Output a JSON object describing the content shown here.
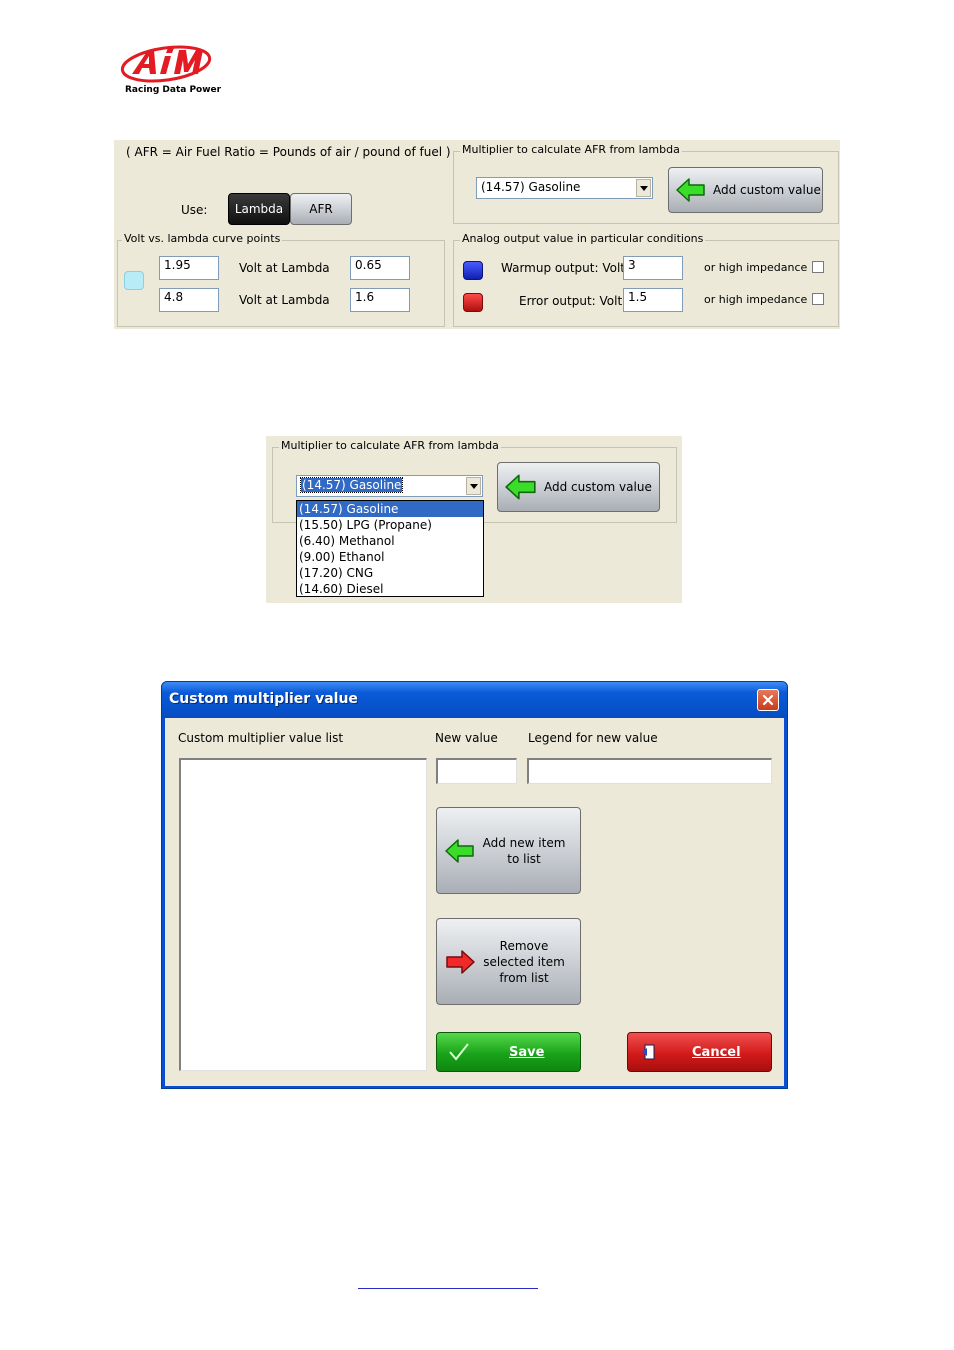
{
  "logo": {
    "brand": "AiM",
    "tagline": "Racing Data Power",
    "color": "#e31b23"
  },
  "panel1": {
    "afr_note": "( AFR = Air Fuel Ratio = Pounds of air / pound of fuel )",
    "use_label": "Use:",
    "toggle_lambda": "Lambda",
    "toggle_afr": "AFR",
    "multiplier_group_title": "Multiplier to calculate AFR from lambda",
    "multiplier_selected": "(14.57) Gasoline",
    "add_custom_label": "Add custom value",
    "curve_group_title": "Volt vs. lambda curve points",
    "curve_rows": [
      {
        "volt": "1.95",
        "volt_label": "Volt  at  Lambda",
        "lambda": "0.65"
      },
      {
        "volt": "4.8",
        "volt_label": "Volt  at  Lambda",
        "lambda": "1.6"
      }
    ],
    "analog_group_title": "Analog output value in particular conditions",
    "warmup_label": "Warmup output: Volt",
    "warmup_value": "3",
    "error_label": "Error output: Volt",
    "error_value": "1.5",
    "high_impedance_label": "or high impedance",
    "colors": {
      "warmup_led": "#1f2fc8",
      "error_led": "#d41414",
      "curve_led": "#b8ecf6"
    }
  },
  "panel2": {
    "group_title": "Multiplier to calculate AFR from lambda",
    "selected": "(14.57) Gasoline",
    "add_custom_label": "Add custom value",
    "options": [
      "(14.57) Gasoline",
      "(15.50) LPG (Propane)",
      "(6.40) Methanol",
      "(9.00) Ethanol",
      "(17.20) CNG",
      "(14.60) Diesel"
    ]
  },
  "dialog": {
    "title": "Custom multiplier value",
    "list_label": "Custom multiplier value list",
    "new_value_label": "New value",
    "legend_label": "Legend for new value",
    "new_value": "",
    "legend_value": "",
    "add_item_label": "Add new item to list",
    "remove_item_label": "Remove selected item from list",
    "save_label": "Save",
    "cancel_label": "Cancel",
    "colors": {
      "titlebar": "#0a5ad8",
      "save": "#1aa31a",
      "cancel": "#d31a1a"
    }
  }
}
